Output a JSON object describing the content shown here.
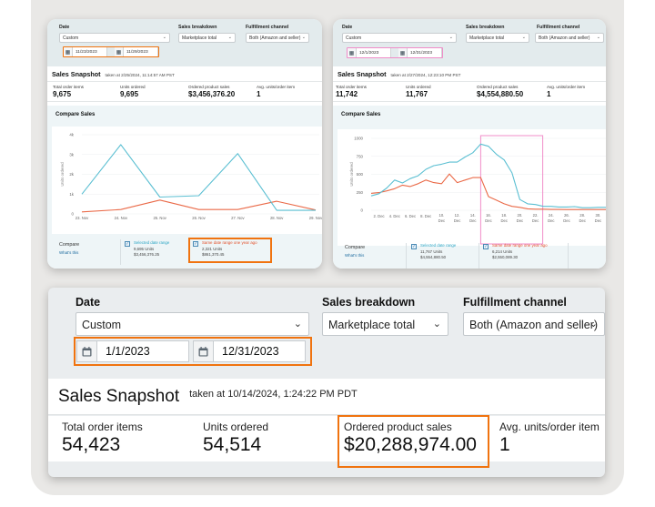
{
  "colors": {
    "highlight_orange": "#f0730f",
    "highlight_pink": "#f08cc8",
    "series_selected": "#5bbfd2",
    "series_last_year": "#ea6a48",
    "link": "#1b6a9e"
  },
  "left_card": {
    "filters": {
      "date_label": "Date",
      "date_select": "Custom",
      "breakdown_label": "Sales breakdown",
      "breakdown_select": "Marketplace total",
      "channel_label": "Fulfillment channel",
      "channel_select": "Both (Amazon and seller)",
      "start_date": "11/23/2023",
      "end_date": "11/29/2023"
    },
    "snapshot": {
      "title": "Sales Snapshot",
      "timestamp": "taken at 2/25/2024, 11:14:57 AM PST"
    },
    "metrics": [
      {
        "label": "Total order items",
        "value": "9,675"
      },
      {
        "label": "Units ordered",
        "value": "9,695"
      },
      {
        "label": "Ordered product sales",
        "value": "$3,456,376.20"
      },
      {
        "label": "Avg. units/order item",
        "value": "1"
      }
    ],
    "compare": {
      "title": "Compare Sales",
      "label": "Compare",
      "whats_this": "What's this",
      "selected": {
        "title": "Selected date range",
        "units": "9,695 Units",
        "sales": "$3,456,376.25"
      },
      "last_year": {
        "title": "Same date range one year ago",
        "units": "2,321 Units",
        "sales": "$861,370.45"
      }
    }
  },
  "right_card": {
    "filters": {
      "date_label": "Date",
      "date_select": "Custom",
      "breakdown_label": "Sales breakdown",
      "breakdown_select": "Marketplace total",
      "channel_label": "Fulfillment channel",
      "channel_select": "Both (Amazon and seller)",
      "start_date": "12/1/2023",
      "end_date": "12/31/2023"
    },
    "snapshot": {
      "title": "Sales Snapshot",
      "timestamp": "taken at 2/27/2024, 12:23:10 PM PST"
    },
    "metrics": [
      {
        "label": "Total order items",
        "value": "11,742"
      },
      {
        "label": "Units ordered",
        "value": "11,767"
      },
      {
        "label": "Ordered product sales",
        "value": "$4,554,880.50"
      },
      {
        "label": "Avg. units/order item",
        "value": "1"
      }
    ],
    "compare": {
      "title": "Compare Sales",
      "label": "Compare",
      "whats_this": "What's this",
      "selected": {
        "title": "Selected date range",
        "units": "11,767 Units",
        "sales": "$4,554,880.50"
      },
      "last_year": {
        "title": "Same date range one year ago",
        "units": "6,214 Units",
        "sales": "$2,550,089.30"
      }
    }
  },
  "main_card": {
    "filters": {
      "date_label": "Date",
      "date_select": "Custom",
      "breakdown_label": "Sales breakdown",
      "breakdown_select": "Marketplace total",
      "channel_label": "Fulfillment channel",
      "channel_select": "Both (Amazon and seller)",
      "start_date": "1/1/2023",
      "end_date": "12/31/2023"
    },
    "snapshot": {
      "title": "Sales Snapshot",
      "timestamp": "taken at 10/14/2024, 1:24:22 PM PDT"
    },
    "metrics": [
      {
        "label": "Total order items",
        "value": "54,423"
      },
      {
        "label": "Units ordered",
        "value": "54,514"
      },
      {
        "label": "Ordered product sales",
        "value": "$20,288,974.00"
      },
      {
        "label": "Avg. units/order item",
        "value": "1"
      }
    ]
  },
  "chart_data": [
    {
      "type": "line",
      "title": "Compare Sales",
      "xlabel": "",
      "ylabel": "Units ordered",
      "categories": [
        "23. Nov",
        "24. Nov",
        "25. Nov",
        "26. Nov",
        "27. Nov",
        "28. Nov",
        "29. Nov"
      ],
      "yticks": [
        "0",
        "1k",
        "2k",
        "3k",
        "4k"
      ],
      "ylim": [
        0,
        4000
      ],
      "grid": true,
      "series": [
        {
          "name": "Selected date range",
          "values": [
            1000,
            3500,
            850,
            920,
            3050,
            180,
            180
          ]
        },
        {
          "name": "Same date range one year ago",
          "values": [
            100,
            220,
            700,
            220,
            220,
            640,
            200
          ]
        }
      ]
    },
    {
      "type": "line",
      "title": "Compare Sales",
      "xlabel": "",
      "ylabel": "Units ordered",
      "categories": [
        "1",
        "2",
        "3",
        "4",
        "5",
        "6",
        "7",
        "8",
        "9",
        "10",
        "11",
        "12",
        "13",
        "14",
        "15",
        "16",
        "17",
        "18",
        "19",
        "20",
        "21",
        "22",
        "23",
        "24",
        "25",
        "26",
        "27",
        "28",
        "29",
        "30",
        "31"
      ],
      "xtick_labels": [
        "2. Dec",
        "4. Dec",
        "6. Dec",
        "8. Dec",
        "10. Dec",
        "12. Dec",
        "14. Dec",
        "16. Dec",
        "18. Dec",
        "20. Dec",
        "22. Dec",
        "24. Dec",
        "26. Dec",
        "28. Dec",
        "30. Dec"
      ],
      "yticks": [
        "0",
        "250",
        "500",
        "750",
        "1000"
      ],
      "ylim": [
        0,
        1000
      ],
      "grid": true,
      "highlight_range": [
        "15",
        "22"
      ],
      "series": [
        {
          "name": "Selected date range",
          "values": [
            200,
            230,
            310,
            420,
            380,
            440,
            480,
            570,
            620,
            640,
            670,
            670,
            740,
            800,
            920,
            890,
            780,
            700,
            520,
            150,
            90,
            80,
            55,
            55,
            45,
            45,
            50,
            35,
            35,
            40,
            40
          ]
        },
        {
          "name": "Same date range one year ago",
          "values": [
            235,
            245,
            270,
            300,
            350,
            330,
            370,
            420,
            385,
            370,
            505,
            385,
            420,
            455,
            455,
            190,
            140,
            90,
            55,
            40,
            20,
            15,
            15,
            12,
            12,
            10,
            10,
            10,
            10,
            10,
            10
          ]
        }
      ]
    }
  ]
}
